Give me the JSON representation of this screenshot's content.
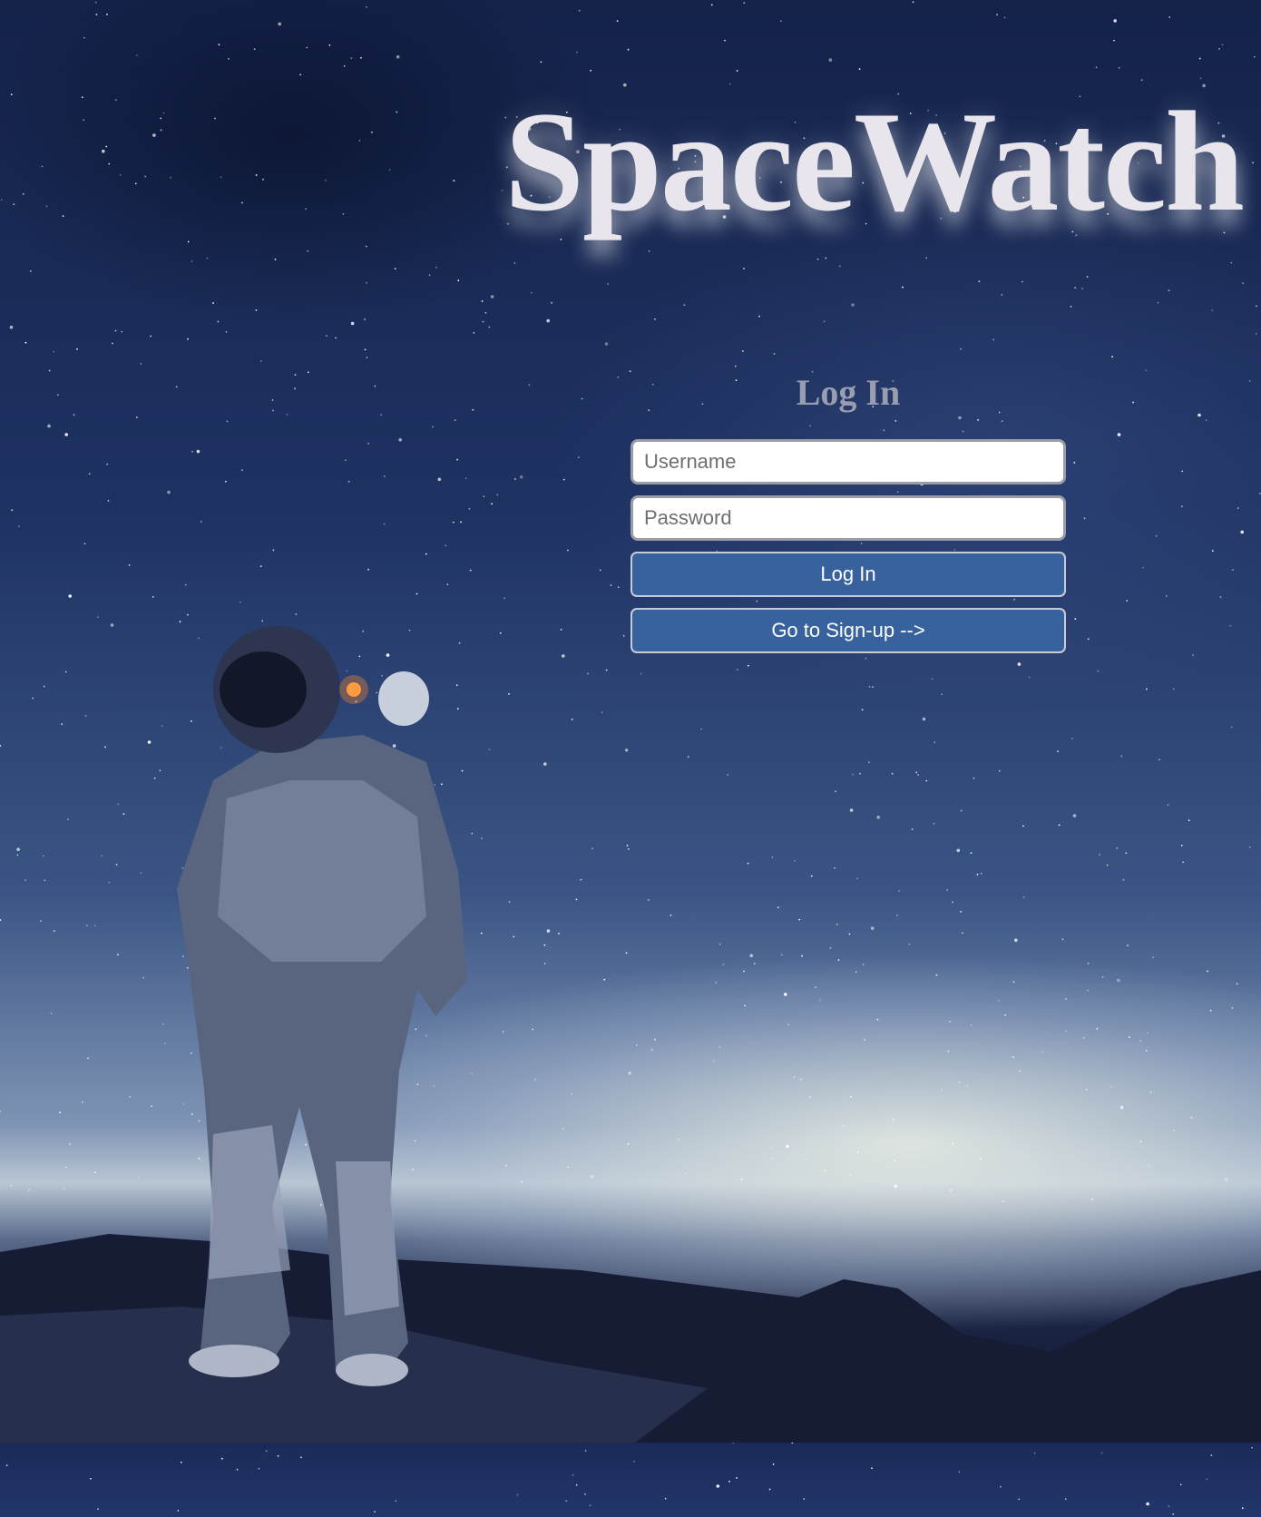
{
  "app": {
    "title": "SpaceWatch"
  },
  "login": {
    "heading": "Log In",
    "username_placeholder": "Username",
    "password_placeholder": "Password",
    "login_button": "Log In",
    "signup_button": "Go to Sign-up -->"
  },
  "theme": {
    "button_color": "#38629e",
    "title_color": "#e8e6ec",
    "heading_color": "#9a9db0"
  }
}
